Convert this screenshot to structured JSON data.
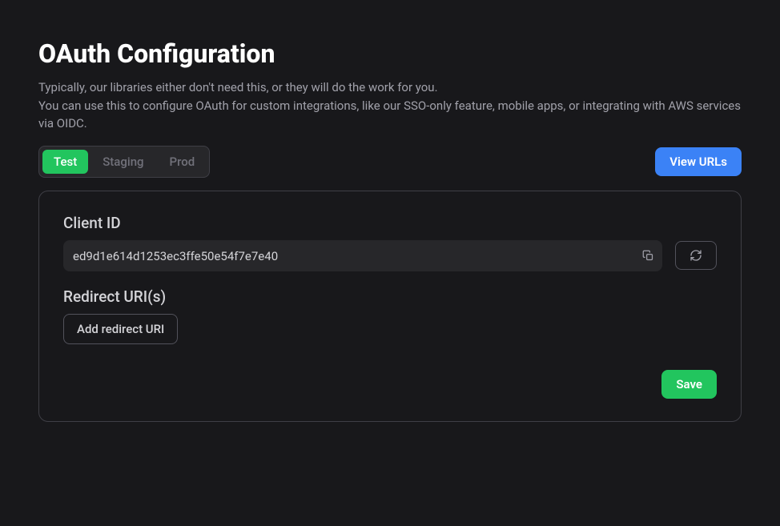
{
  "header": {
    "title": "OAuth Configuration",
    "description_line1": "Typically, our libraries either don't need this, or they will do the work for you.",
    "description_line2": "You can use this to configure OAuth for custom integrations, like our SSO-only feature, mobile apps, or integrating with AWS services via OIDC."
  },
  "tabs": {
    "items": [
      {
        "label": "Test",
        "active": true
      },
      {
        "label": "Staging",
        "active": false
      },
      {
        "label": "Prod",
        "active": false
      }
    ]
  },
  "toolbar": {
    "view_urls_label": "View URLs"
  },
  "panel": {
    "client_id_label": "Client ID",
    "client_id_value": "ed9d1e614d1253ec3ffe50e54f7e7e40",
    "redirect_uris_label": "Redirect URI(s)",
    "add_redirect_uri_label": "Add redirect URI",
    "save_label": "Save"
  }
}
